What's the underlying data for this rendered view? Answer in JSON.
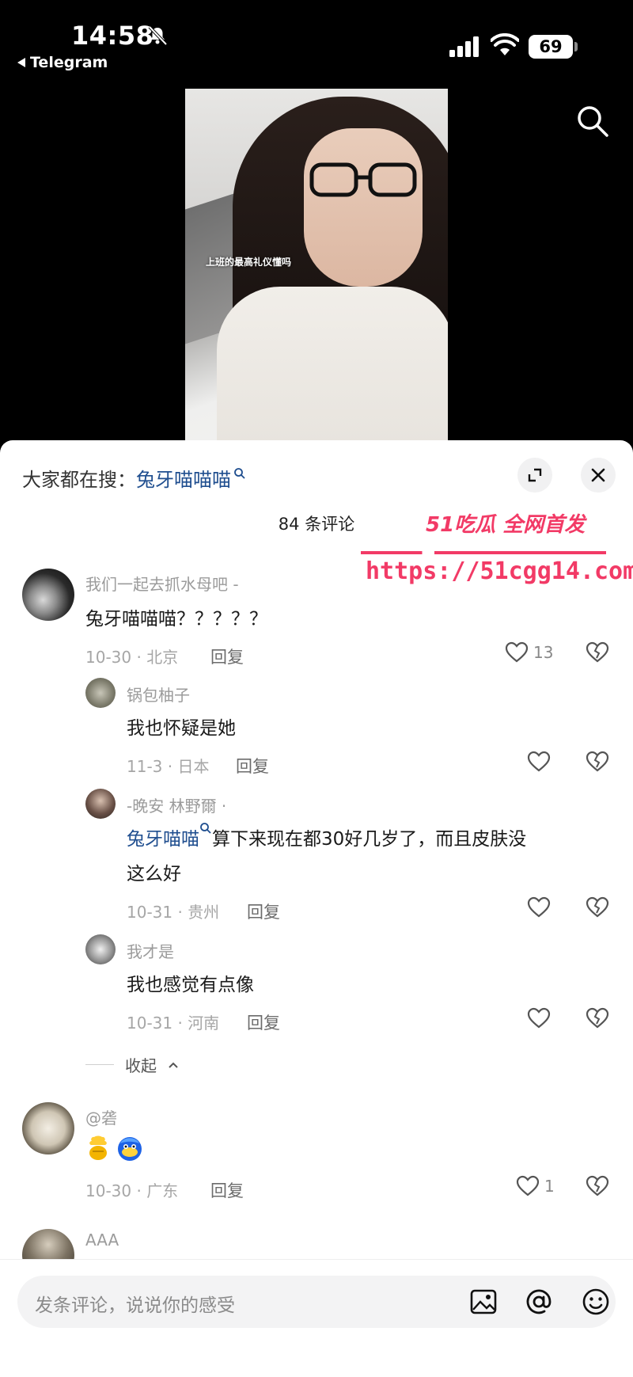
{
  "status_bar": {
    "time": "14:58",
    "back_app": "Telegram",
    "battery": "69"
  },
  "video": {
    "caption": "上班的最高礼仪懂吗"
  },
  "sheet": {
    "trend_prefix": "大家都在搜：",
    "trend_keyword": "兔牙喵喵喵",
    "comment_count": "84 条评论"
  },
  "watermark": {
    "line1": "51吃瓜 全网首发",
    "line2": "https://51cgg14.com"
  },
  "comments": [
    {
      "user": "我们一起去抓水母吧 -",
      "text": "兔牙喵喵喵？？？？？",
      "meta": "10-30 · 北京",
      "reply": "回复",
      "likes": "13",
      "replies": [
        {
          "user": "锅包柚子",
          "text": "我也怀疑是她",
          "meta": "11-3 · 日本",
          "reply": "回复"
        },
        {
          "user": "-晚安 林野爾 ·",
          "mention": "兔牙喵喵",
          "text_line1": "算下来现在都30好几岁了，而且皮肤没",
          "text_line2": "这么好",
          "meta": "10-31 · 贵州",
          "reply": "回复"
        },
        {
          "user": "我才是",
          "text": "我也感觉有点像",
          "meta": "10-31 · 河南",
          "reply": "回复"
        }
      ],
      "collapse": "收起"
    },
    {
      "user": "@砻",
      "text": "",
      "meta": "10-30 · 广东",
      "reply": "回复",
      "likes": "1"
    },
    {
      "user": "AAA"
    }
  ],
  "input": {
    "placeholder": "发条评论，说说你的感受"
  },
  "colors": {
    "accent_link": "#1f4e8f",
    "watermark": "#f23a66"
  },
  "icons": [
    "mute-icon",
    "signal-icon",
    "wifi-icon",
    "search-icon",
    "expand-icon",
    "close-icon",
    "heart-icon",
    "broken-heart-icon",
    "image-icon",
    "at-icon",
    "emoji-icon"
  ]
}
